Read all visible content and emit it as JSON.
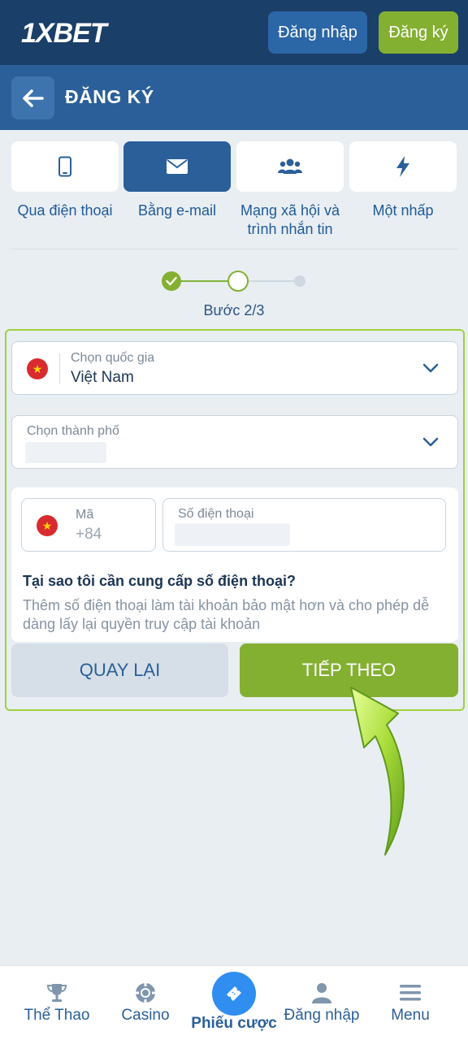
{
  "topbar": {
    "logo": "1XBET",
    "login_label": "Đăng nhập",
    "register_label": "Đăng ký"
  },
  "header": {
    "title": "ĐĂNG KÝ"
  },
  "methods": [
    {
      "label": "Qua điện thoại",
      "icon": "phone-icon",
      "active": false
    },
    {
      "label": "Bằng e-mail",
      "icon": "envelope-icon",
      "active": true
    },
    {
      "label": "Mạng xã hội và trình nhắn tin",
      "icon": "users-icon",
      "active": false
    },
    {
      "label": "Một nhấp",
      "icon": "lightning-icon",
      "active": false
    }
  ],
  "stepper": {
    "label": "Bước 2/3",
    "current": 2,
    "total": 3
  },
  "form": {
    "country_label": "Chọn quốc gia",
    "country_value": "Việt Nam",
    "city_label": "Chọn thành phố",
    "code_label": "Mã",
    "code_value": "+84",
    "phone_label": "Số điện thoại",
    "why_title": "Tại sao tôi cần cung cấp số điện thoại?",
    "why_text": "Thêm số điện thoại làm tài khoản bảo mật hơn và cho phép dễ dàng lấy lại quyền truy cập tài khoản",
    "back_label": "QUAY LẠI",
    "next_label": "TIẾP THEO"
  },
  "colors": {
    "brand_dark": "#1a3f68",
    "brand": "#2a5f99",
    "accent_green": "#84b032",
    "nav_highlight": "#2f8ef0"
  },
  "bottom_nav": {
    "sports": "Thể Thao",
    "casino": "Casino",
    "betslip": "Phiếu cược",
    "login": "Đăng nhập",
    "menu": "Menu"
  }
}
